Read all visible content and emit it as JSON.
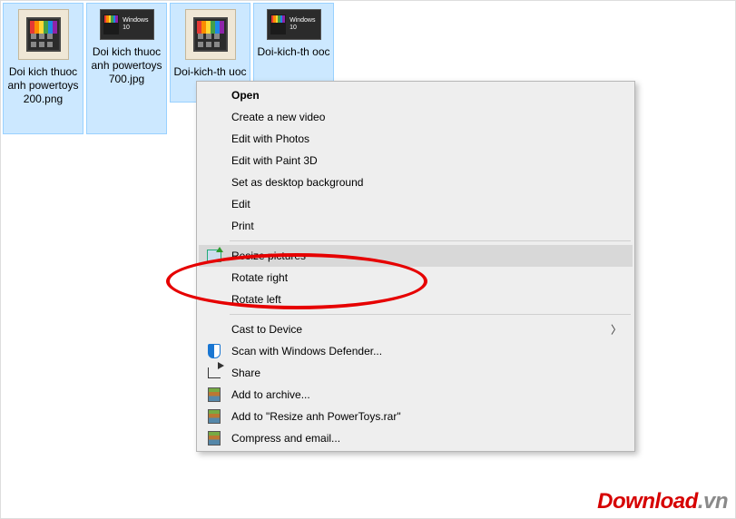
{
  "files": [
    {
      "name": "Doi kich thuoc anh powertoys 200.png",
      "thumb": "large"
    },
    {
      "name": "Doi kich thuoc anh powertoys 700.jpg",
      "thumb": "small",
      "badge": "Windows 10"
    },
    {
      "name": "Doi-kich-th uoc web",
      "thumb": "large"
    },
    {
      "name": "Doi-kich-th ooc",
      "thumb": "small",
      "badge": "Windows 10"
    }
  ],
  "menu": {
    "open": "Open",
    "create_video": "Create a new video",
    "edit_photos": "Edit with Photos",
    "edit_paint3d": "Edit with Paint 3D",
    "set_bg": "Set as desktop background",
    "edit": "Edit",
    "print": "Print",
    "resize": "Resize pictures",
    "rotate_right": "Rotate right",
    "rotate_left": "Rotate left",
    "cast": "Cast to Device",
    "defender": "Scan with Windows Defender...",
    "share": "Share",
    "add_archive": "Add to archive...",
    "add_named": "Add to \"Resize anh PowerToys.rar\"",
    "compress_email": "Compress and email..."
  },
  "watermark": {
    "d": "Download",
    "vn": ".vn"
  },
  "highlighted_item": "resize"
}
